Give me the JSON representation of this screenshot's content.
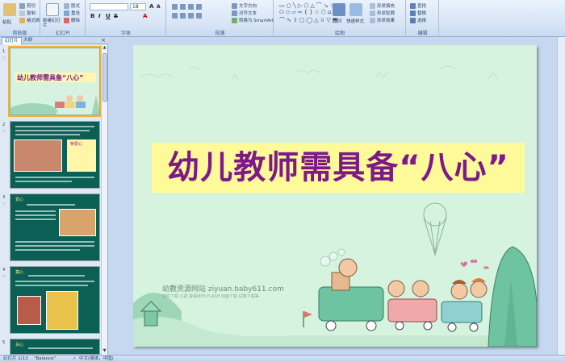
{
  "ribbon": {
    "clipboard": {
      "label": "剪贴板",
      "paste": "粘贴",
      "cut": "剪切",
      "copy": "复制",
      "format_painter": "格式刷"
    },
    "slides": {
      "label": "幻灯片",
      "new_slide": "新建幻灯片",
      "layout": "版式",
      "reset": "重设",
      "delete": "删除"
    },
    "font": {
      "label": "字体",
      "size": "18"
    },
    "paragraph": {
      "label": "段落",
      "text_direction": "文字方向",
      "align_text": "对齐文本",
      "smartart": "转换为 SmartArt"
    },
    "drawing": {
      "label": "绘图",
      "arrange": "排列",
      "quick_styles": "快速样式",
      "shape_fill": "形状填充",
      "shape_outline": "形状轮廓",
      "shape_effects": "形状效果"
    },
    "editing": {
      "label": "编辑",
      "find": "查找",
      "replace": "替换",
      "select": "选择"
    }
  },
  "panel": {
    "tab_slides": "幻灯片",
    "tab_outline": "大纲",
    "close": "×",
    "thumbs": [
      {
        "num": "1",
        "title": "幼儿教师需具备“八心”"
      },
      {
        "num": "2",
        "label": "特爱心"
      },
      {
        "num": "3",
        "label": "爱心"
      },
      {
        "num": "4",
        "label": "童心"
      },
      {
        "num": "5",
        "label": "关心"
      }
    ]
  },
  "slide": {
    "title": "幼儿教师需具备“八心”",
    "website": "幼教资源网站  ziyuan.baby611.com",
    "website_desc": "课件下载 儿歌 故事MP3 FLASH 动画下载 试卷下载等"
  },
  "status": {
    "slide_pos": "幻灯片 1/13",
    "theme": "\"Balance\"",
    "language": "中文(简体，中国)"
  },
  "colors": {
    "title": "#7d1a87",
    "title_bg": "#fffa99",
    "slide_bg": "#d5f3df",
    "thumb_dark": "#0b5f55"
  }
}
